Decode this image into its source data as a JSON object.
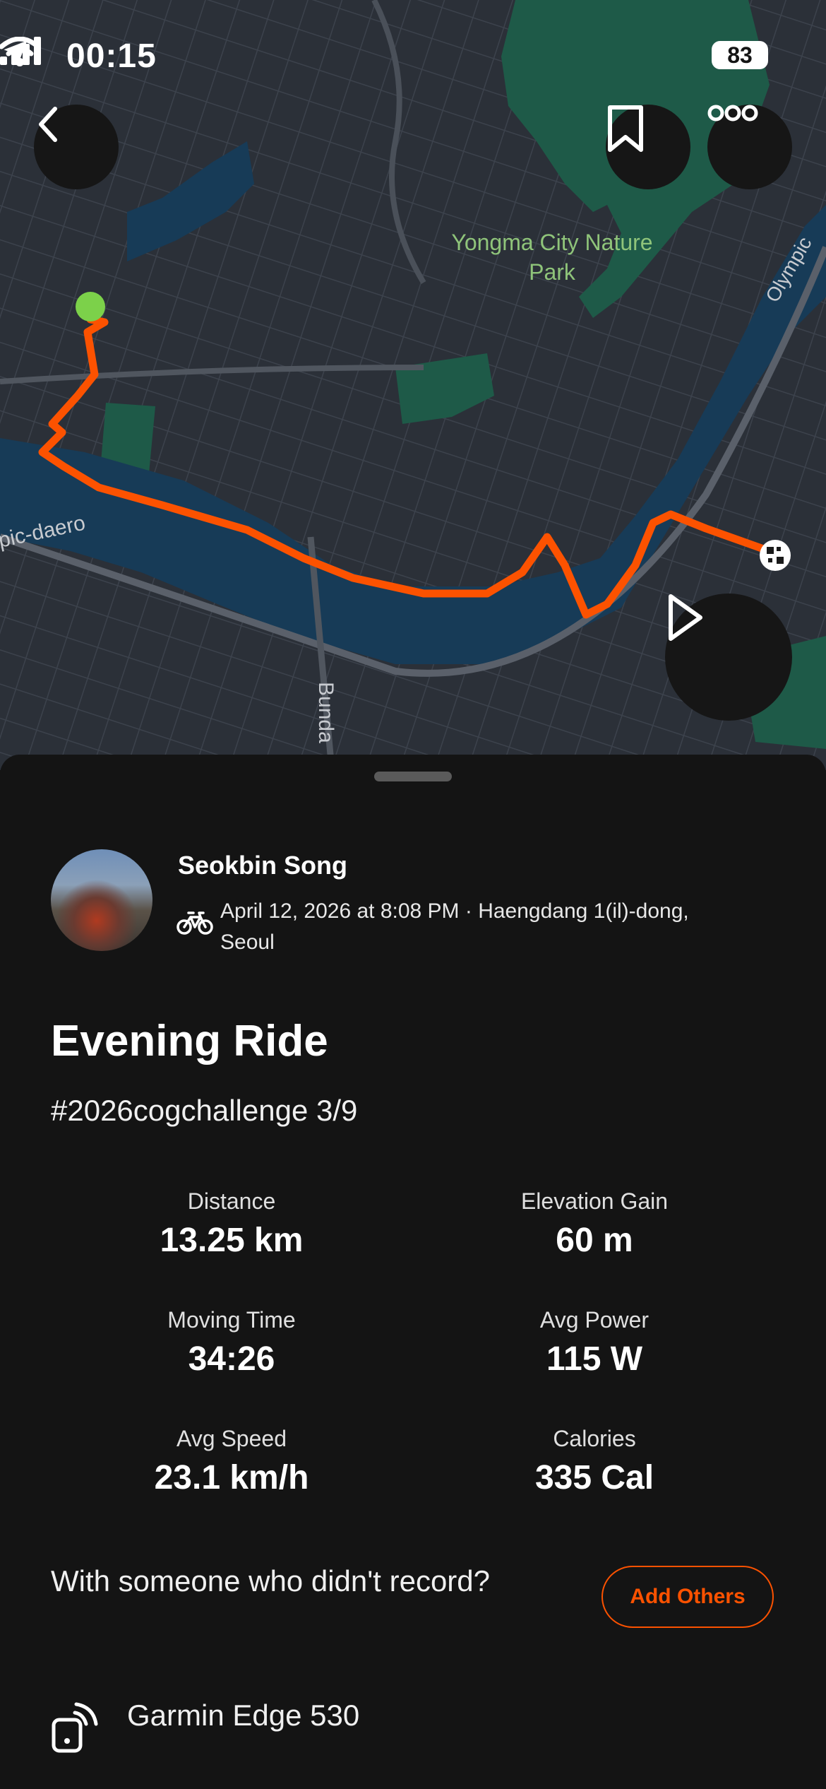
{
  "status_bar": {
    "time": "00:15",
    "battery": "83"
  },
  "map": {
    "labels": {
      "park": [
        "Yongma City Nature",
        "Park"
      ],
      "road_left": "pic-daero",
      "road_right": "Olympic",
      "road_bottom": "Bunda"
    }
  },
  "icons": {
    "back": "chevron-left-icon",
    "bookmark": "bookmark-icon",
    "more": "more-icon",
    "play": "play-icon",
    "sport": "bike-icon",
    "device": "device-signal-icon"
  },
  "colors": {
    "route": "#fc5200",
    "start": "#7cd14a",
    "accent": "#fc5200"
  },
  "activity": {
    "athlete_name": "Seokbin Song",
    "meta": "April 12, 2026 at 8:08 PM · Haengdang 1(il)-dong, Seoul",
    "title": "Evening Ride",
    "description": "#2026cogchallenge  3/9"
  },
  "stats": [
    {
      "label": "Distance",
      "value": "13.25 km"
    },
    {
      "label": "Elevation Gain",
      "value": "60 m"
    },
    {
      "label": "Moving Time",
      "value": "34:26"
    },
    {
      "label": "Avg Power",
      "value": "115 W"
    },
    {
      "label": "Avg Speed",
      "value": "23.1 km/h"
    },
    {
      "label": "Calories",
      "value": "335 Cal"
    }
  ],
  "others": {
    "prompt": "With someone who didn't record?",
    "button": "Add Others"
  },
  "device": {
    "name": "Garmin Edge 530"
  }
}
